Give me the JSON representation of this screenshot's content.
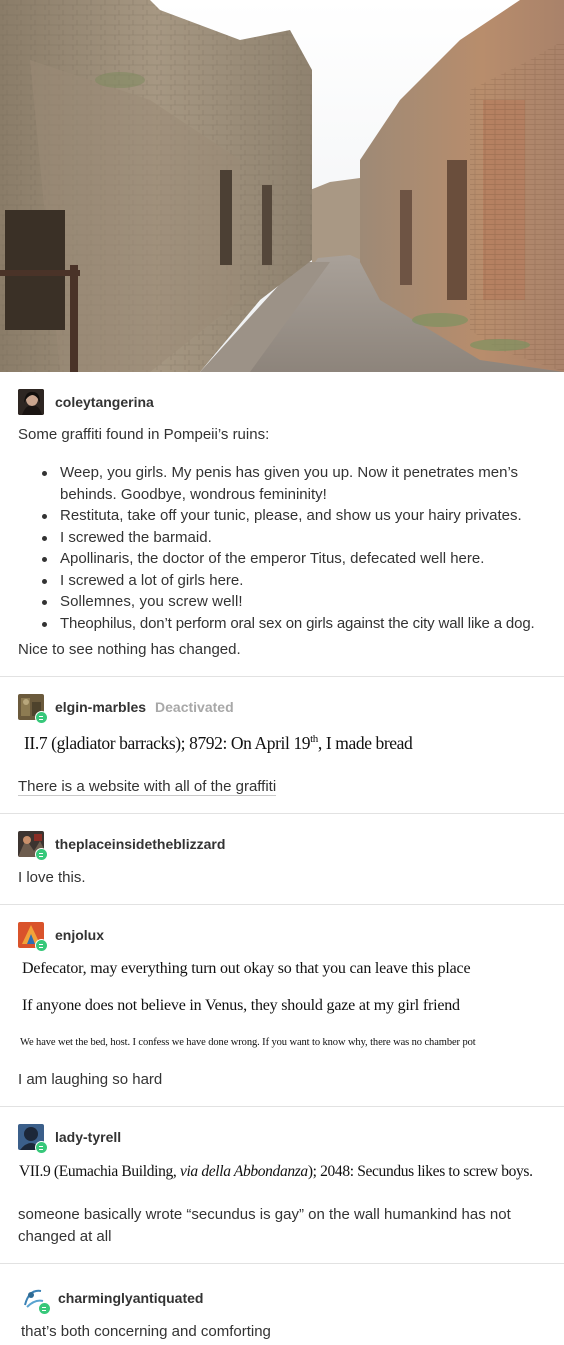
{
  "posts": [
    {
      "username": "coleytangerina",
      "intro": "Some graffiti found in Pompeii’s ruins:",
      "items": [
        "Weep, you girls. My penis has given you up. Now it penetrates men’s behinds. Goodbye, wondrous femininity!",
        "Restituta, take off your tunic, please, and show us your hairy privates.",
        "I screwed the barmaid.",
        "Apollinaris, the doctor of the emperor Titus, defecated well here.",
        "I screwed a lot of girls here.",
        "Sollemnes, you screw well!",
        "Theophilus, don’t perform oral sex on girls against the city wall like a dog."
      ],
      "outro": "Nice to see nothing has changed."
    },
    {
      "username": "elgin-marbles",
      "status": "Deactivated",
      "quote_main": "II.7 (gladiator barracks); 8792: On April 19",
      "quote_sup": "th",
      "quote_end": ", I made bread",
      "text": "There is a website with all of the graffiti"
    },
    {
      "username": "theplaceinsidetheblizzard",
      "text": "I love this."
    },
    {
      "username": "enjolux",
      "quote_1": "Defecator, may everything turn out okay so that you can leave this place",
      "quote_2": "If anyone does not believe in Venus, they should gaze at my girl friend",
      "quote_3": "We have wet the bed, host.  I confess we have done wrong.  If you want to know why, there was no chamber pot",
      "text": "I am laughing so hard"
    },
    {
      "username": "lady-tyrell",
      "quote_a": "VII.9 (Eumachia Building, ",
      "quote_b": "via della Abbondanza",
      "quote_c": "); 2048: Secundus likes to screw boys.",
      "text": "someone basically wrote “secundus is gay” on the wall humankind has not changed at all"
    },
    {
      "username": "charminglyantiquated",
      "text": "that’s both concerning and comforting"
    }
  ]
}
